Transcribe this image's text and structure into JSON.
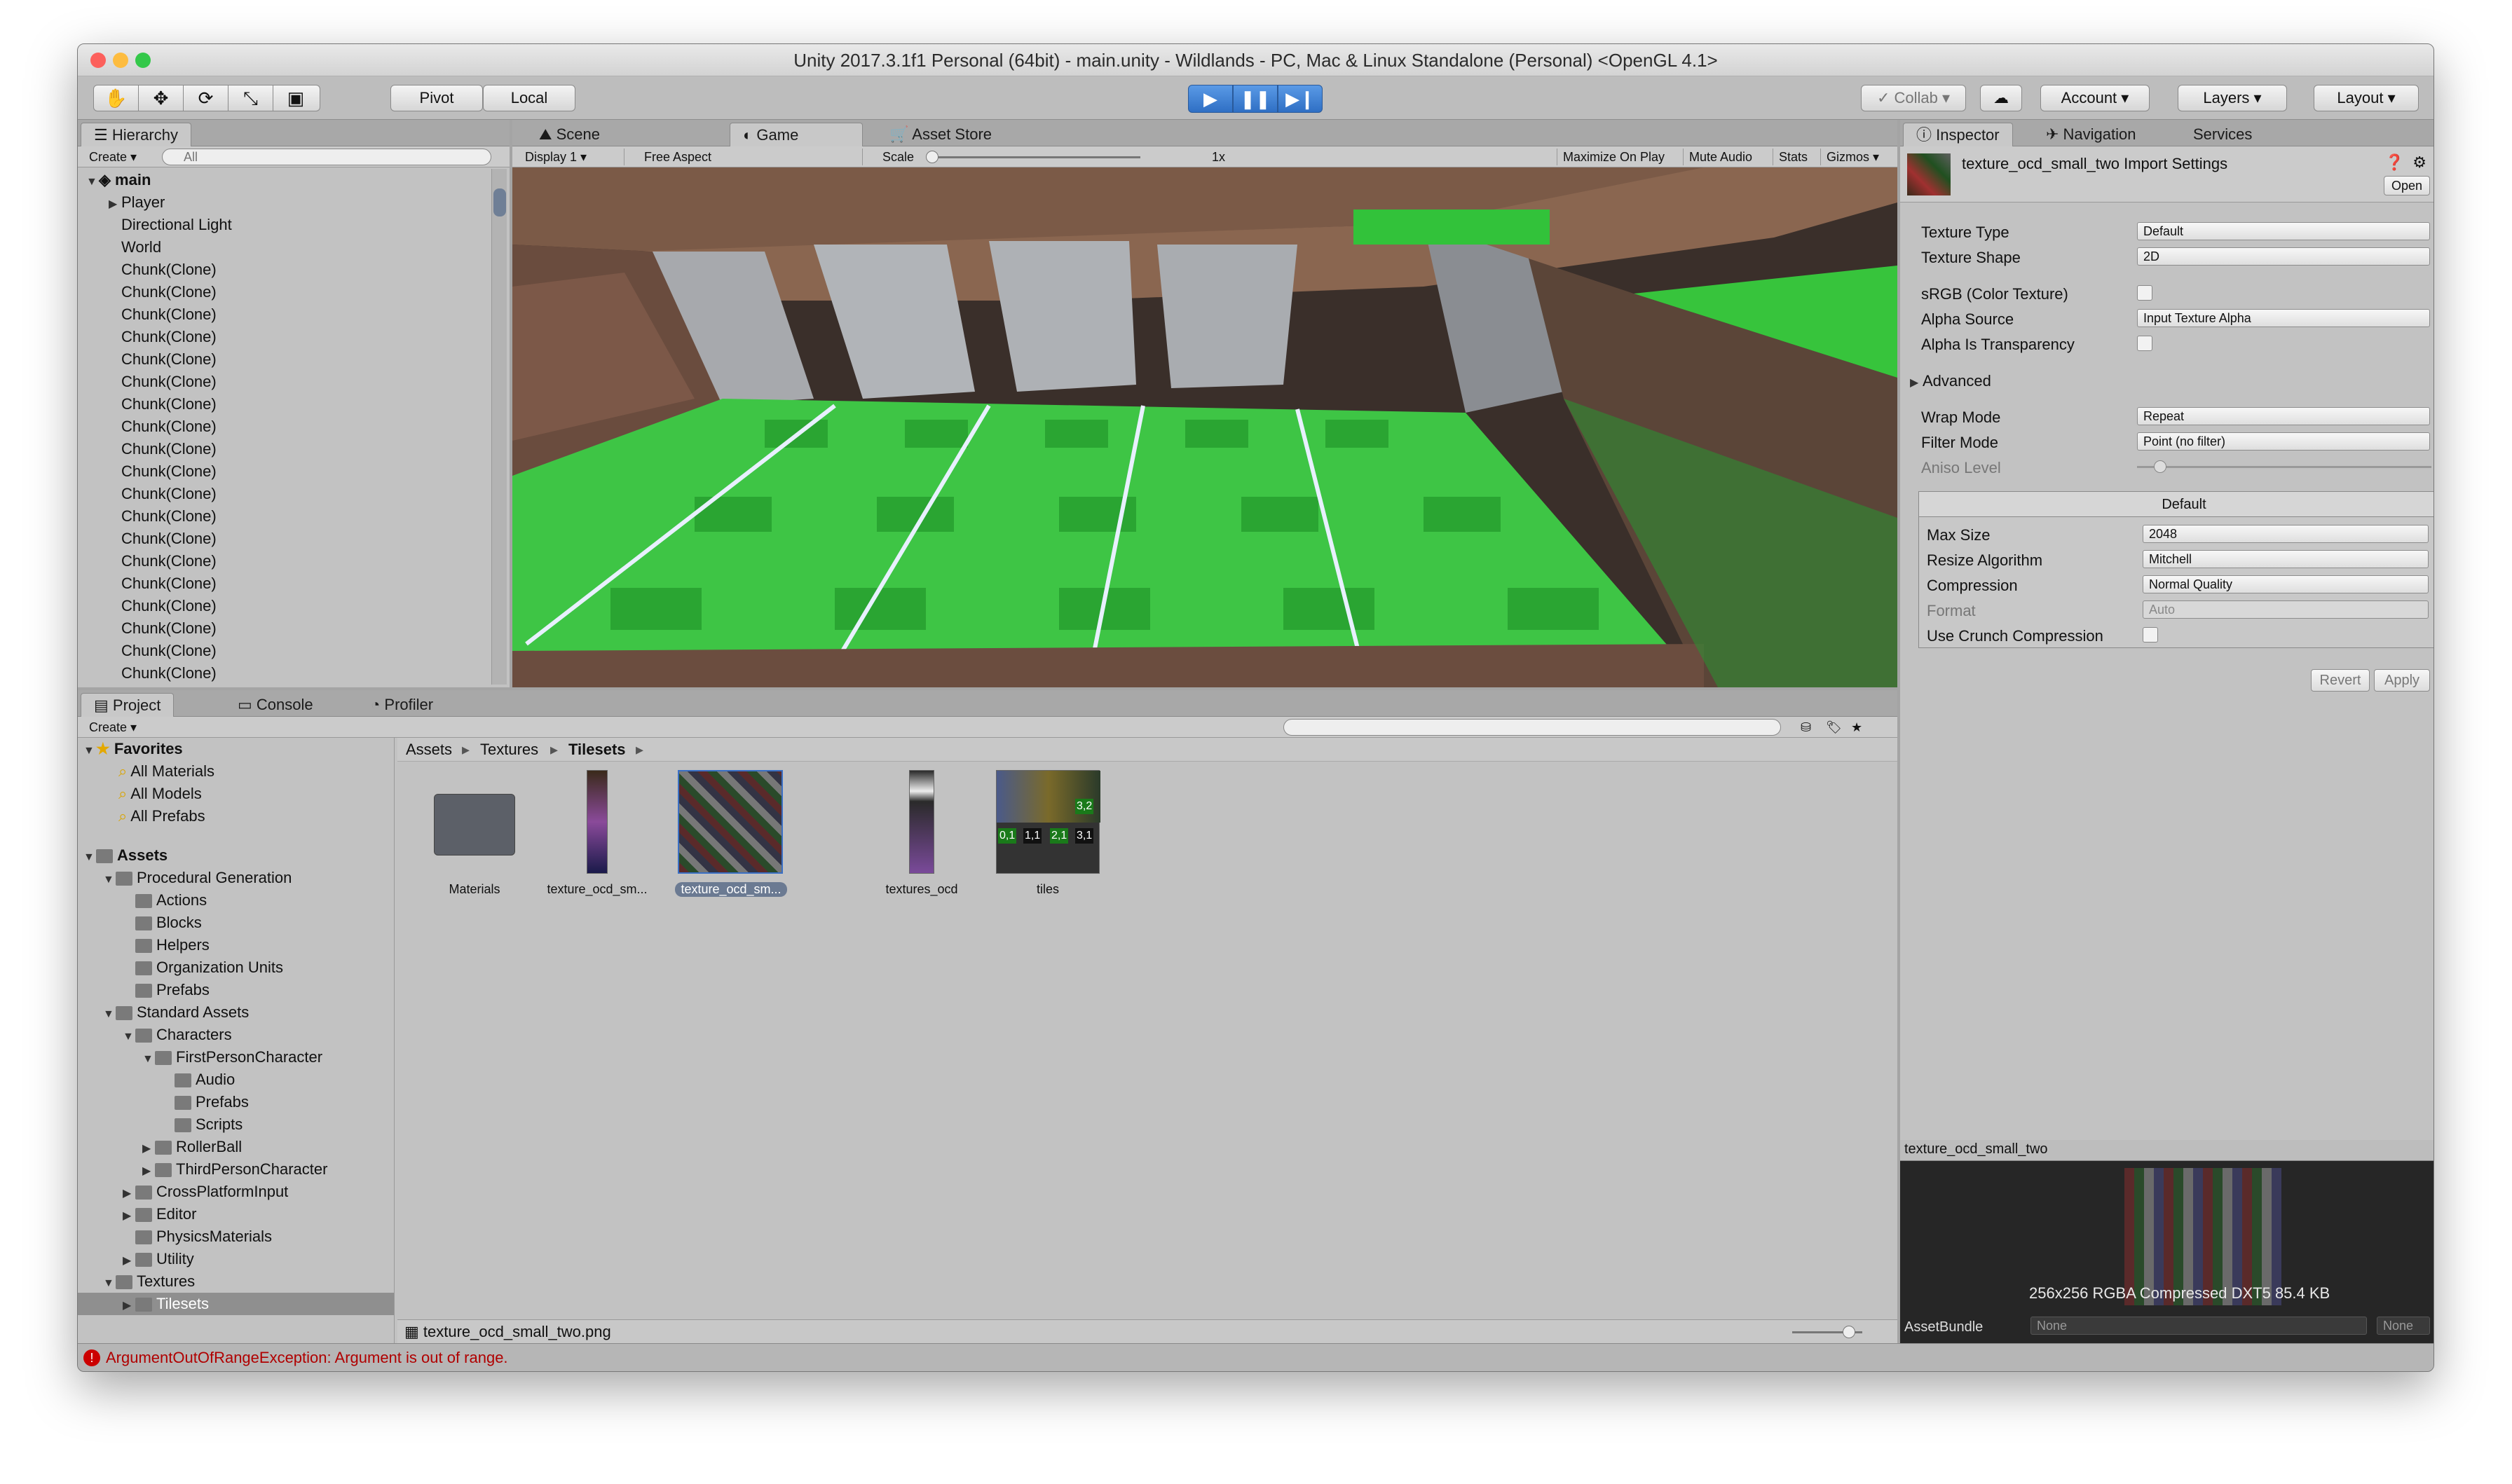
{
  "window": {
    "title": "Unity 2017.3.1f1 Personal (64bit) - main.unity - Wildlands - PC, Mac & Linux Standalone (Personal) <OpenGL 4.1>"
  },
  "toolbar": {
    "pivot": "Pivot",
    "local": "Local",
    "collab": "Collab",
    "account": "Account",
    "layers": "Layers",
    "layout": "Layout"
  },
  "hierarchy": {
    "tab": "Hierarchy",
    "create": "Create",
    "search_placeholder": "All",
    "scene": "main",
    "items": [
      "Player",
      "Directional Light",
      "World",
      "Chunk(Clone)",
      "Chunk(Clone)",
      "Chunk(Clone)",
      "Chunk(Clone)",
      "Chunk(Clone)",
      "Chunk(Clone)",
      "Chunk(Clone)",
      "Chunk(Clone)",
      "Chunk(Clone)",
      "Chunk(Clone)",
      "Chunk(Clone)",
      "Chunk(Clone)",
      "Chunk(Clone)",
      "Chunk(Clone)",
      "Chunk(Clone)",
      "Chunk(Clone)",
      "Chunk(Clone)",
      "Chunk(Clone)",
      "Chunk(Clone)"
    ]
  },
  "view": {
    "tabs": [
      "Scene",
      "Game",
      "Asset Store"
    ],
    "display": "Display 1",
    "aspect": "Free Aspect",
    "scale_label": "Scale",
    "scale_value": "1x",
    "maximize": "Maximize On Play",
    "mute": "Mute Audio",
    "stats": "Stats",
    "gizmos": "Gizmos"
  },
  "inspector": {
    "tabs": [
      "Inspector",
      "Navigation",
      "Services"
    ],
    "header_title": "texture_ocd_small_two Import Settings",
    "open": "Open",
    "texture_type_label": "Texture Type",
    "texture_type": "Default",
    "texture_shape_label": "Texture Shape",
    "texture_shape": "2D",
    "srgb_label": "sRGB (Color Texture)",
    "alpha_source_label": "Alpha Source",
    "alpha_source": "Input Texture Alpha",
    "alpha_transparency_label": "Alpha Is Transparency",
    "advanced": "Advanced",
    "wrap_mode_label": "Wrap Mode",
    "wrap_mode": "Repeat",
    "filter_mode_label": "Filter Mode",
    "filter_mode": "Point (no filter)",
    "aniso_label": "Aniso Level",
    "aniso_value": "1",
    "platform_default": "Default",
    "max_size_label": "Max Size",
    "max_size": "2048",
    "resize_label": "Resize Algorithm",
    "resize": "Mitchell",
    "compression_label": "Compression",
    "compression": "Normal Quality",
    "format_label": "Format",
    "format": "Auto",
    "crunch_label": "Use Crunch Compression",
    "revert": "Revert",
    "apply": "Apply",
    "preview_title": "texture_ocd_small_two",
    "preview_info": "256x256  RGBA Compressed DXT5   85.4 KB",
    "assetbundle_label": "AssetBundle",
    "assetbundle_value": "None",
    "assetbundle_variant": "None"
  },
  "project": {
    "tabs": [
      "Project",
      "Console",
      "Profiler"
    ],
    "create": "Create",
    "favorites": "Favorites",
    "favorite_items": [
      "All Materials",
      "All Models",
      "All Prefabs"
    ],
    "assets": "Assets",
    "tree": [
      {
        "label": "Procedural Generation",
        "depth": 1,
        "open": true
      },
      {
        "label": "Actions",
        "depth": 2
      },
      {
        "label": "Blocks",
        "depth": 2
      },
      {
        "label": "Helpers",
        "depth": 2
      },
      {
        "label": "Organization Units",
        "depth": 2
      },
      {
        "label": "Prefabs",
        "depth": 2
      },
      {
        "label": "Standard Assets",
        "depth": 1,
        "open": true
      },
      {
        "label": "Characters",
        "depth": 2,
        "open": true
      },
      {
        "label": "FirstPersonCharacter",
        "depth": 3,
        "open": true
      },
      {
        "label": "Audio",
        "depth": 4
      },
      {
        "label": "Prefabs",
        "depth": 4
      },
      {
        "label": "Scripts",
        "depth": 4
      },
      {
        "label": "RollerBall",
        "depth": 3,
        "closed": true
      },
      {
        "label": "ThirdPersonCharacter",
        "depth": 3,
        "closed": true
      },
      {
        "label": "CrossPlatformInput",
        "depth": 2,
        "closed": true
      },
      {
        "label": "Editor",
        "depth": 2,
        "closed": true
      },
      {
        "label": "PhysicsMaterials",
        "depth": 2
      },
      {
        "label": "Utility",
        "depth": 2,
        "closed": true
      },
      {
        "label": "Textures",
        "depth": 1,
        "open": true
      },
      {
        "label": "Tilesets",
        "depth": 2,
        "closed": true,
        "selected": true
      }
    ],
    "breadcrumb": [
      "Assets",
      "Textures",
      "Tilesets"
    ],
    "assets_grid": [
      "Materials",
      "texture_ocd_sm...",
      "texture_ocd_sm...",
      "textures_ocd",
      "tiles"
    ],
    "tile_labels": [
      "0,1",
      "1,1",
      "2,1",
      "3,1",
      "3,2"
    ],
    "selected_file": "texture_ocd_small_two.png"
  },
  "status": {
    "message": "ArgumentOutOfRangeException: Argument is out of range."
  }
}
